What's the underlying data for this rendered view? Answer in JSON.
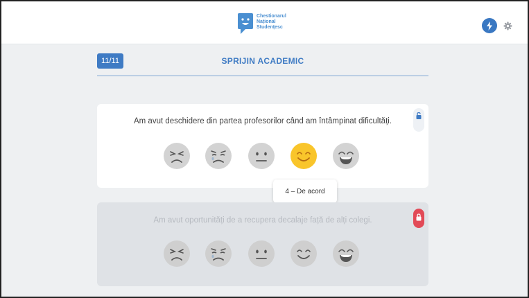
{
  "header": {
    "logo_lines": [
      "Chestionarul",
      "Național",
      "Studențesc"
    ],
    "icons": {
      "logo": "speech-bubble-logo",
      "action": "lightning-bolt-icon",
      "settings": "gear-icon"
    }
  },
  "section": {
    "progress": "11/11",
    "title": "SPRIJIN ACADEMIC"
  },
  "questions": [
    {
      "text": "Am avut deschidere din partea profesorilor când am întâmpinat dificultăți.",
      "active": true,
      "lock_state": "unlocked",
      "selected_rating": 4,
      "tooltip": "4 – De acord"
    },
    {
      "text": "Am avut oportunități de a recupera decalaje față de alți colegi.",
      "active": false,
      "lock_state": "locked",
      "selected_rating": null
    }
  ],
  "rating_faces": [
    "very-angry-face-icon",
    "sad-face-icon",
    "neutral-face-icon",
    "smiling-face-icon",
    "happy-face-icon"
  ],
  "colors": {
    "accent": "#3f7bc4",
    "selected_face": "#f9c52b",
    "lock_active": "#e24a57",
    "face_gray": "#d3d3d3"
  }
}
